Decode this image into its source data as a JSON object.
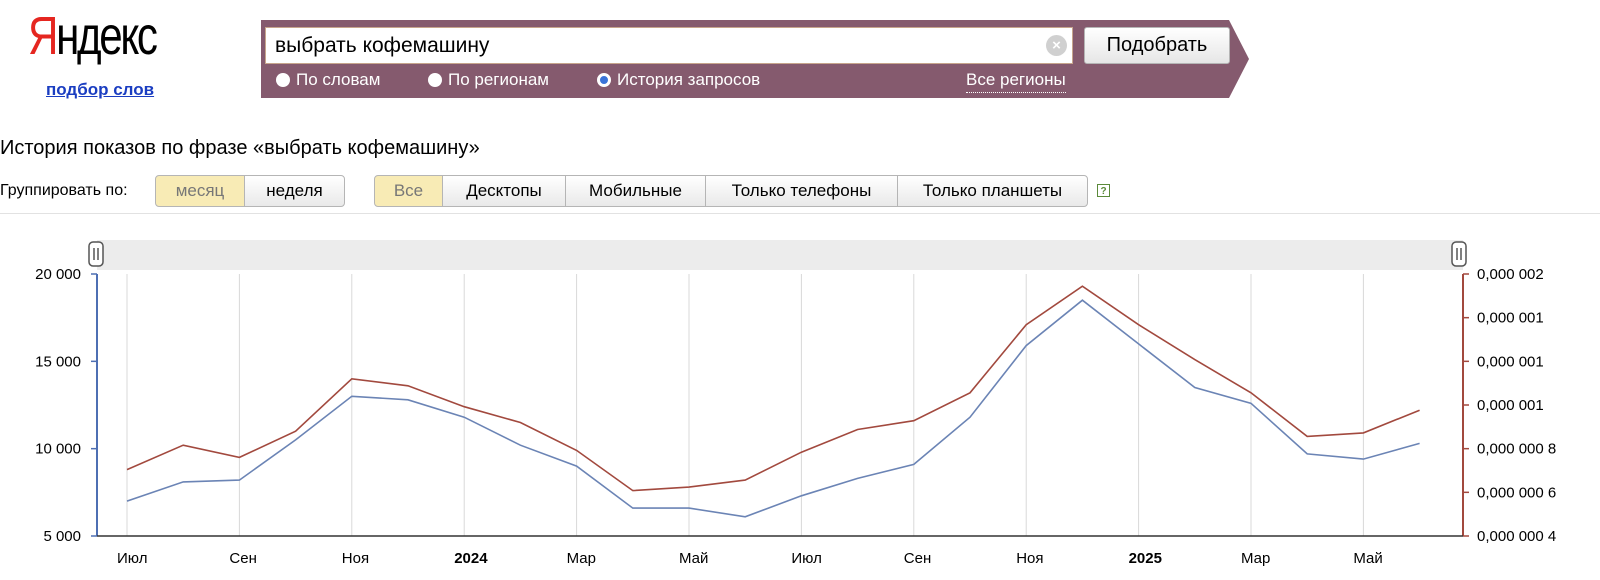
{
  "logo": {
    "text_first": "Я",
    "text_rest": "ндекс",
    "sublink": "подбор слов"
  },
  "search": {
    "value": "выбрать кофемашину",
    "submit_label": "Подобрать",
    "radios": [
      {
        "label": "По словам",
        "checked": false
      },
      {
        "label": "По регионам",
        "checked": false
      },
      {
        "label": "История запросов",
        "checked": true
      }
    ],
    "regions_link": "Все регионы"
  },
  "heading": "История показов по фразе «выбрать кофемашину»",
  "grouping": {
    "label": "Группировать по:",
    "options": [
      "месяц",
      "неделя"
    ],
    "active": "месяц"
  },
  "devices": {
    "options": [
      "Все",
      "Десктопы",
      "Мобильные",
      "Только телефоны",
      "Только планшеты"
    ],
    "active": "Все"
  },
  "colors": {
    "band": "#855a6e",
    "absolute_series": "#6b84b5",
    "relative_series": "#a2493e",
    "left_axis": "#4e6fb3",
    "right_axis": "#a2493e"
  },
  "chart_data": {
    "type": "line",
    "x": [
      "2023-07",
      "2023-08",
      "2023-09",
      "2023-10",
      "2023-11",
      "2023-12",
      "2024-01",
      "2024-02",
      "2024-03",
      "2024-04",
      "2024-05",
      "2024-06",
      "2024-07",
      "2024-08",
      "2024-09",
      "2024-10",
      "2024-11",
      "2024-12",
      "2025-01",
      "2025-02",
      "2025-03",
      "2025-04",
      "2025-05",
      "2025-06"
    ],
    "x_tick_labels": [
      "Июл",
      "Сен",
      "Ноя",
      "2024",
      "Мар",
      "Май",
      "Июл",
      "Сен",
      "Ноя",
      "2025",
      "Мар",
      "Май"
    ],
    "x_tick_months": [
      "2023-07",
      "2023-09",
      "2023-11",
      "2024-01",
      "2024-03",
      "2024-05",
      "2024-07",
      "2024-09",
      "2024-11",
      "2025-01",
      "2025-03",
      "2025-05"
    ],
    "x_tick_bold": [
      "2024",
      "2025"
    ],
    "y_left": {
      "ticks": [
        "20 000",
        "15 000",
        "10 000",
        "5 000"
      ],
      "tick_values": [
        20000,
        15000,
        10000,
        5000
      ],
      "range": [
        5000,
        20000
      ]
    },
    "y_right": {
      "ticks": [
        "0,000 002",
        "0,000 001",
        "0,000 001",
        "0,000 001",
        "0,000 000 8",
        "0,000 000 6",
        "0,000 000 4"
      ]
    },
    "series": [
      {
        "axis": "left",
        "values": [
          7000,
          8100,
          8200,
          10500,
          13000,
          12800,
          11800,
          10200,
          9000,
          6600,
          6600,
          6100,
          7300,
          8300,
          9100,
          11800,
          15900,
          18500,
          16000,
          13500,
          12600,
          9700,
          9400,
          10300
        ]
      },
      {
        "axis": "right_scaled_to_left",
        "values": [
          8800,
          10200,
          9500,
          11000,
          14000,
          13600,
          12400,
          11500,
          9900,
          7600,
          7800,
          8200,
          9800,
          11100,
          11600,
          13200,
          17100,
          19300,
          17100,
          15100,
          13200,
          10700,
          10900,
          12200
        ]
      }
    ]
  }
}
